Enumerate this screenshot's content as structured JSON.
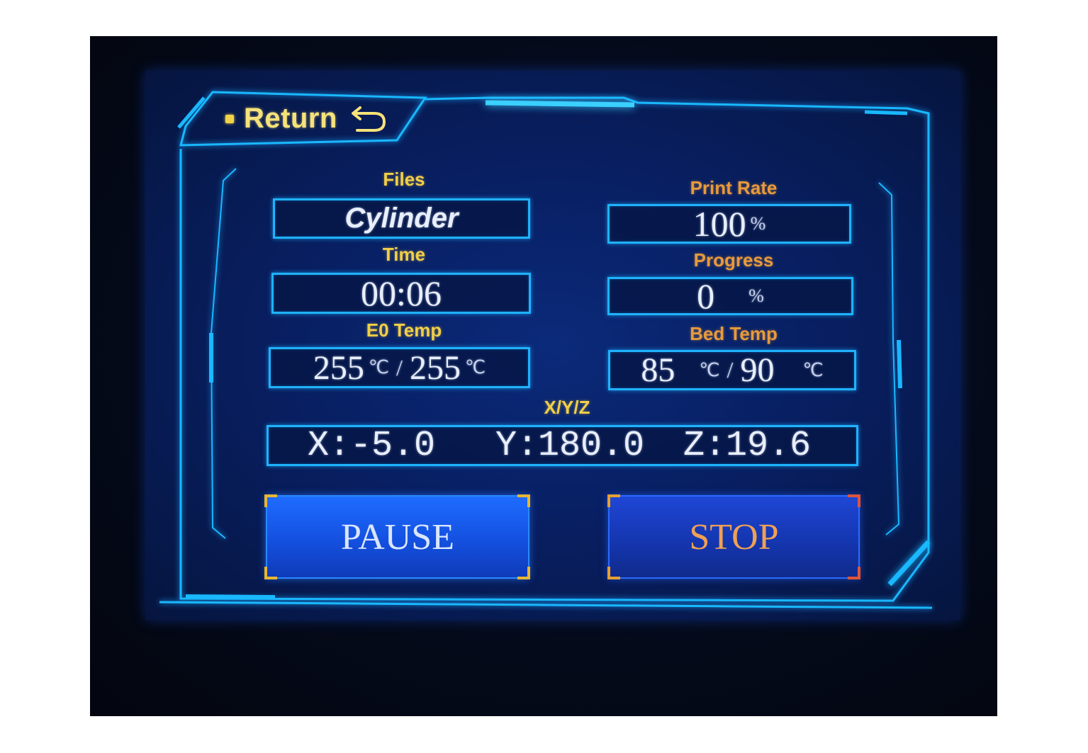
{
  "header": {
    "return_label": "Return"
  },
  "files": {
    "label": "Files",
    "value": "Cylinder"
  },
  "time": {
    "label": "Time",
    "value": "00:06"
  },
  "e0_temp": {
    "label": "E0 Temp",
    "current": "255",
    "target": "255",
    "unit": "℃",
    "separator": "/"
  },
  "print_rate": {
    "label": "Print Rate",
    "value": "100",
    "unit": "%"
  },
  "progress": {
    "label": "Progress",
    "value": "0",
    "unit": "%"
  },
  "bed_temp": {
    "label": "Bed Temp",
    "current": "85",
    "target": "90",
    "unit": "℃",
    "separator": "/"
  },
  "xyz": {
    "label": "X/Y/Z",
    "x": "X:-5.0",
    "y": "Y:180.0",
    "z": "Z:19.6"
  },
  "controls": {
    "pause_label": "PAUSE",
    "stop_label": "STOP"
  },
  "colors": {
    "neon": "#19b8ff",
    "label_yellow": "#f0cf48",
    "label_orange": "#e79a3c",
    "screen_bg": "#081f62"
  },
  "icons": {
    "return": "return-arrow-icon"
  }
}
